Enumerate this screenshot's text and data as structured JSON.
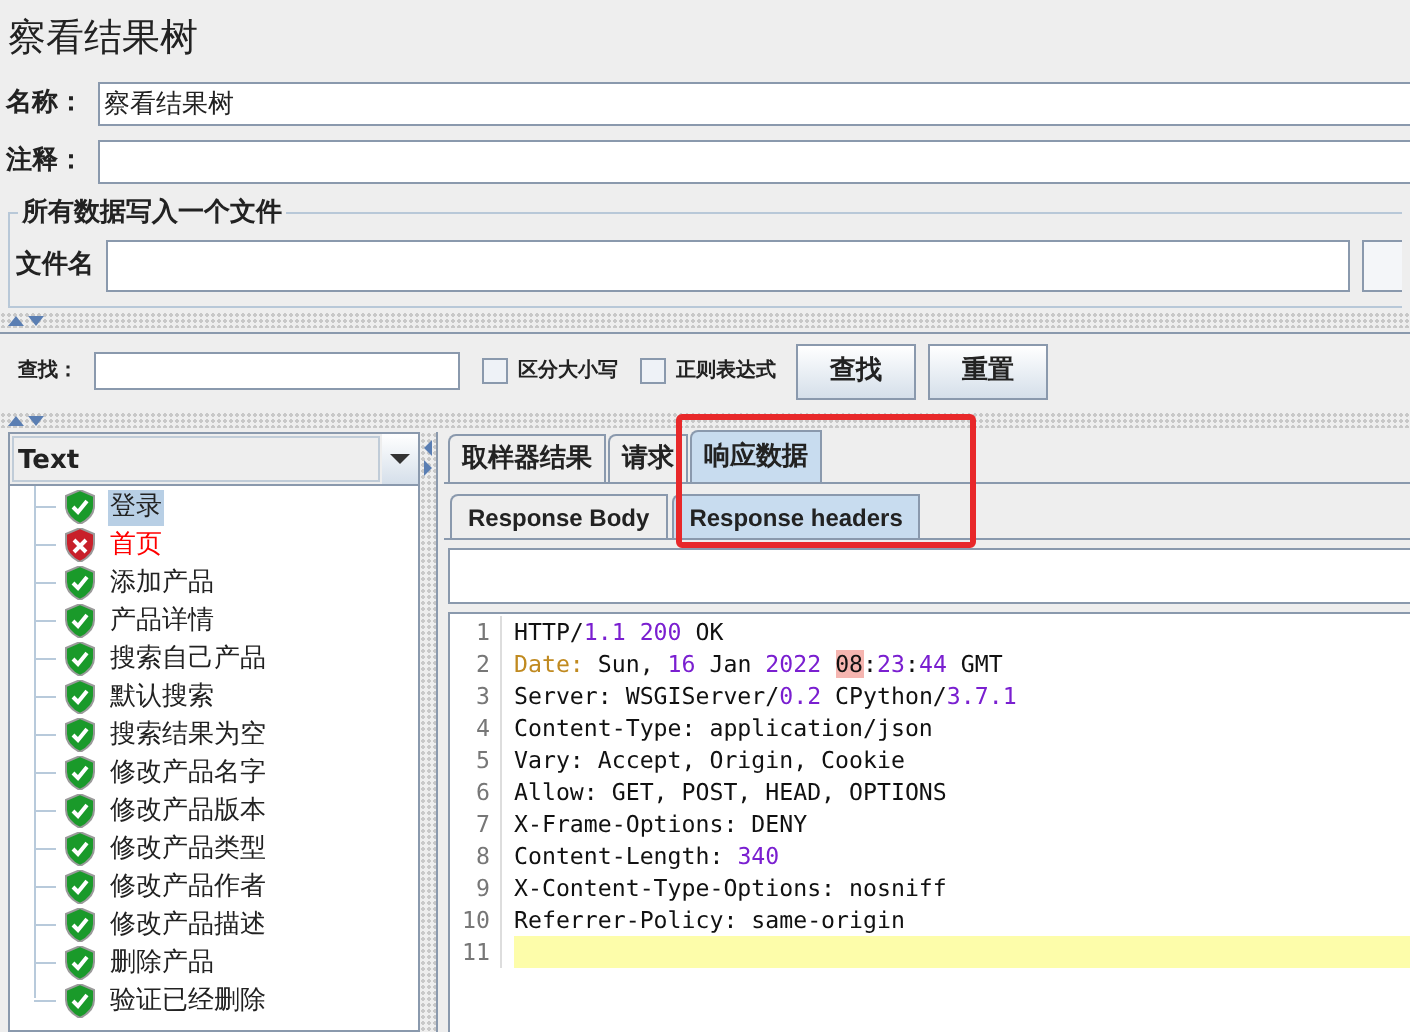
{
  "window": {
    "title": "察看结果树"
  },
  "name_field": {
    "label": "名称：",
    "value": "察看结果树"
  },
  "comment_field": {
    "label": "注释："
  },
  "file_group": {
    "title": "所有数据写入一个文件",
    "label": "文件名"
  },
  "search": {
    "label": "查找：",
    "options": [
      {
        "label": "区分大小写",
        "checked": false
      },
      {
        "label": "正则表达式",
        "checked": false
      }
    ],
    "buttons": [
      "查找",
      "重置"
    ]
  },
  "renderer": {
    "value": "Text"
  },
  "tree": [
    {
      "label": "登录",
      "passed": true,
      "selected": true
    },
    {
      "label": "首页",
      "passed": false,
      "selected": false
    },
    {
      "label": "添加产品",
      "passed": true,
      "selected": false
    },
    {
      "label": "产品详情",
      "passed": true,
      "selected": false
    },
    {
      "label": "搜索自己产品",
      "passed": true,
      "selected": false
    },
    {
      "label": "默认搜索",
      "passed": true,
      "selected": false
    },
    {
      "label": "搜索结果为空",
      "passed": true,
      "selected": false
    },
    {
      "label": "修改产品名字",
      "passed": true,
      "selected": false
    },
    {
      "label": "修改产品版本",
      "passed": true,
      "selected": false
    },
    {
      "label": "修改产品类型",
      "passed": true,
      "selected": false
    },
    {
      "label": "修改产品作者",
      "passed": true,
      "selected": false
    },
    {
      "label": "修改产品描述",
      "passed": true,
      "selected": false
    },
    {
      "label": "删除产品",
      "passed": true,
      "selected": false
    },
    {
      "label": "验证已经删除",
      "passed": true,
      "selected": false
    }
  ],
  "tabs": [
    {
      "label": "取样器结果",
      "selected": false
    },
    {
      "label": "请求",
      "selected": false
    },
    {
      "label": "响应数据",
      "selected": true
    }
  ],
  "subtabs": [
    {
      "label": "Response Body",
      "selected": false
    },
    {
      "label": "Response headers",
      "selected": true
    }
  ],
  "annotation": {
    "kind": "rectangle"
  },
  "code": [
    {
      "number": "1",
      "segments": [
        {
          "text": "HTTP/",
          "kind": "plain"
        },
        {
          "text": "1.1 200",
          "kind": "num"
        },
        {
          "text": " OK",
          "kind": "plain"
        }
      ]
    },
    {
      "number": "2",
      "segments": [
        {
          "text": "Date:",
          "kind": "key"
        },
        {
          "text": " Sun, ",
          "kind": "plain"
        },
        {
          "text": "16",
          "kind": "num"
        },
        {
          "text": " Jan ",
          "kind": "plain"
        },
        {
          "text": "2022 ",
          "kind": "num"
        },
        {
          "text": "08",
          "kind": "mark"
        },
        {
          "text": ":",
          "kind": "plain"
        },
        {
          "text": "23",
          "kind": "num"
        },
        {
          "text": ":",
          "kind": "plain"
        },
        {
          "text": "44",
          "kind": "num"
        },
        {
          "text": " GMT",
          "kind": "plain"
        }
      ]
    },
    {
      "number": "3",
      "segments": [
        {
          "text": "Server: WSGIServer/",
          "kind": "plain"
        },
        {
          "text": "0.2",
          "kind": "num"
        },
        {
          "text": " CPython/",
          "kind": "plain"
        },
        {
          "text": "3.7.1",
          "kind": "num"
        }
      ]
    },
    {
      "number": "4",
      "segments": [
        {
          "text": "Content-Type: application/json",
          "kind": "plain"
        }
      ]
    },
    {
      "number": "5",
      "segments": [
        {
          "text": "Vary: Accept, Origin, Cookie",
          "kind": "plain"
        }
      ]
    },
    {
      "number": "6",
      "segments": [
        {
          "text": "Allow: GET, POST, HEAD, OPTIONS",
          "kind": "plain"
        }
      ]
    },
    {
      "number": "7",
      "segments": [
        {
          "text": "X-Frame-Options: DENY",
          "kind": "plain"
        }
      ]
    },
    {
      "number": "8",
      "segments": [
        {
          "text": "Content-Length: ",
          "kind": "plain"
        },
        {
          "text": "340",
          "kind": "num"
        }
      ]
    },
    {
      "number": "9",
      "segments": [
        {
          "text": "X-Content-Type-Options: nosniff",
          "kind": "plain"
        }
      ]
    },
    {
      "number": "10",
      "segments": [
        {
          "text": "Referrer-Policy: same-origin",
          "kind": "plain"
        }
      ]
    },
    {
      "number": "11",
      "current": true
    }
  ]
}
